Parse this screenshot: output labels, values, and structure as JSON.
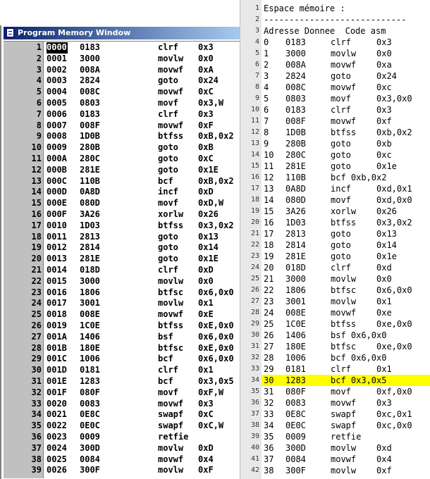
{
  "left_window": {
    "title": "Program Memory Window",
    "rows": [
      [
        "1",
        "0000",
        "0183",
        "clrf",
        "0x3"
      ],
      [
        "2",
        "0001",
        "3000",
        "movlw",
        "0x0"
      ],
      [
        "3",
        "0002",
        "008A",
        "movwf",
        "0xA"
      ],
      [
        "4",
        "0003",
        "2824",
        "goto",
        "0x24"
      ],
      [
        "5",
        "0004",
        "008C",
        "movwf",
        "0xC"
      ],
      [
        "6",
        "0005",
        "0803",
        "movf",
        "0x3,W"
      ],
      [
        "7",
        "0006",
        "0183",
        "clrf",
        "0x3"
      ],
      [
        "8",
        "0007",
        "008F",
        "movwf",
        "0xF"
      ],
      [
        "9",
        "0008",
        "1D0B",
        "btfss",
        "0xB,0x2"
      ],
      [
        "10",
        "0009",
        "280B",
        "goto",
        "0xB"
      ],
      [
        "11",
        "000A",
        "280C",
        "goto",
        "0xC"
      ],
      [
        "12",
        "000B",
        "281E",
        "goto",
        "0x1E"
      ],
      [
        "13",
        "000C",
        "110B",
        "bcf",
        "0xB,0x2"
      ],
      [
        "14",
        "000D",
        "0A8D",
        "incf",
        "0xD"
      ],
      [
        "15",
        "000E",
        "080D",
        "movf",
        "0xD,W"
      ],
      [
        "16",
        "000F",
        "3A26",
        "xorlw",
        "0x26"
      ],
      [
        "17",
        "0010",
        "1D03",
        "btfss",
        "0x3,0x2"
      ],
      [
        "18",
        "0011",
        "2813",
        "goto",
        "0x13"
      ],
      [
        "19",
        "0012",
        "2814",
        "goto",
        "0x14"
      ],
      [
        "20",
        "0013",
        "281E",
        "goto",
        "0x1E"
      ],
      [
        "21",
        "0014",
        "018D",
        "clrf",
        "0xD"
      ],
      [
        "22",
        "0015",
        "3000",
        "movlw",
        "0x0"
      ],
      [
        "23",
        "0016",
        "1806",
        "btfsc",
        "0x6,0x0"
      ],
      [
        "24",
        "0017",
        "3001",
        "movlw",
        "0x1"
      ],
      [
        "25",
        "0018",
        "008E",
        "movwf",
        "0xE"
      ],
      [
        "26",
        "0019",
        "1C0E",
        "btfss",
        "0xE,0x0"
      ],
      [
        "27",
        "001A",
        "1406",
        "bsf",
        "0x6,0x0"
      ],
      [
        "28",
        "001B",
        "180E",
        "btfsc",
        "0xE,0x0"
      ],
      [
        "29",
        "001C",
        "1006",
        "bcf",
        "0x6,0x0"
      ],
      [
        "30",
        "001D",
        "0181",
        "clrf",
        "0x1"
      ],
      [
        "31",
        "001E",
        "1283",
        "bcf",
        "0x3,0x5"
      ],
      [
        "32",
        "001F",
        "080F",
        "movf",
        "0xF,W"
      ],
      [
        "33",
        "0020",
        "0083",
        "movwf",
        "0x3"
      ],
      [
        "34",
        "0021",
        "0E8C",
        "swapf",
        "0xC"
      ],
      [
        "35",
        "0022",
        "0E0C",
        "swapf",
        "0xC,W"
      ],
      [
        "36",
        "0023",
        "0009",
        "retfie",
        ""
      ],
      [
        "37",
        "0024",
        "300D",
        "movlw",
        "0xD"
      ],
      [
        "38",
        "0025",
        "0084",
        "movwf",
        "0x4"
      ],
      [
        "39",
        "0026",
        "300F",
        "movlw",
        "0xF"
      ]
    ]
  },
  "right_listing": {
    "header_lines": [
      [
        "1",
        "Espace mémoire :"
      ],
      [
        "2",
        "----------------------------"
      ],
      [
        "3",
        "Adresse Donnee  Code asm"
      ]
    ],
    "rows": [
      [
        "4",
        "0",
        "0183",
        "clrf",
        "0x3"
      ],
      [
        "5",
        "1",
        "3000",
        "movlw",
        "0x0"
      ],
      [
        "6",
        "2",
        "008A",
        "movwf",
        "0xa"
      ],
      [
        "7",
        "3",
        "2824",
        "goto",
        "0x24"
      ],
      [
        "8",
        "4",
        "008C",
        "movwf",
        "0xc"
      ],
      [
        "9",
        "5",
        "0803",
        "movf",
        "0x3,0x0"
      ],
      [
        "10",
        "6",
        "0183",
        "clrf",
        "0x3"
      ],
      [
        "11",
        "7",
        "008F",
        "movwf",
        "0xf"
      ],
      [
        "12",
        "8",
        "1D0B",
        "btfss",
        "0xb,0x2"
      ],
      [
        "13",
        "9",
        "280B",
        "goto",
        "0xb"
      ],
      [
        "14",
        "10",
        "280C",
        "goto",
        "0xc"
      ],
      [
        "15",
        "11",
        "281E",
        "goto",
        "0x1e"
      ],
      [
        "16",
        "12",
        "110B",
        "bcf 0xb,0x2",
        ""
      ],
      [
        "17",
        "13",
        "0A8D",
        "incf",
        "0xd,0x1"
      ],
      [
        "18",
        "14",
        "080D",
        "movf",
        "0xd,0x0"
      ],
      [
        "19",
        "15",
        "3A26",
        "xorlw",
        "0x26"
      ],
      [
        "20",
        "16",
        "1D03",
        "btfss",
        "0x3,0x2"
      ],
      [
        "21",
        "17",
        "2813",
        "goto",
        "0x13"
      ],
      [
        "22",
        "18",
        "2814",
        "goto",
        "0x14"
      ],
      [
        "23",
        "19",
        "281E",
        "goto",
        "0x1e"
      ],
      [
        "24",
        "20",
        "018D",
        "clrf",
        "0xd"
      ],
      [
        "25",
        "21",
        "3000",
        "movlw",
        "0x0"
      ],
      [
        "26",
        "22",
        "1806",
        "btfsc",
        "0x6,0x0"
      ],
      [
        "27",
        "23",
        "3001",
        "movlw",
        "0x1"
      ],
      [
        "28",
        "24",
        "008E",
        "movwf",
        "0xe"
      ],
      [
        "29",
        "25",
        "1C0E",
        "btfss",
        "0xe,0x0"
      ],
      [
        "30",
        "26",
        "1406",
        "bsf 0x6,0x0",
        ""
      ],
      [
        "31",
        "27",
        "180E",
        "btfsc",
        "0xe,0x0"
      ],
      [
        "32",
        "28",
        "1006",
        "bcf 0x6,0x0",
        ""
      ],
      [
        "33",
        "29",
        "0181",
        "clrf",
        "0x1"
      ],
      [
        "34",
        "30",
        "1283",
        "bcf 0x3,0x5",
        ""
      ],
      [
        "35",
        "31",
        "080F",
        "movf",
        "0xf,0x0"
      ],
      [
        "36",
        "32",
        "0083",
        "movwf",
        "0x3"
      ],
      [
        "37",
        "33",
        "0E8C",
        "swapf",
        "0xc,0x1"
      ],
      [
        "38",
        "34",
        "0E0C",
        "swapf",
        "0xc,0x0"
      ],
      [
        "39",
        "35",
        "0009",
        "retfie",
        ""
      ],
      [
        "40",
        "36",
        "300D",
        "movlw",
        "0xd"
      ],
      [
        "41",
        "37",
        "0084",
        "movwf",
        "0x4"
      ],
      [
        "42",
        "38",
        "300F",
        "movlw",
        "0xf"
      ]
    ],
    "highlight_line": "34",
    "highlight_color": "#ffff00"
  }
}
